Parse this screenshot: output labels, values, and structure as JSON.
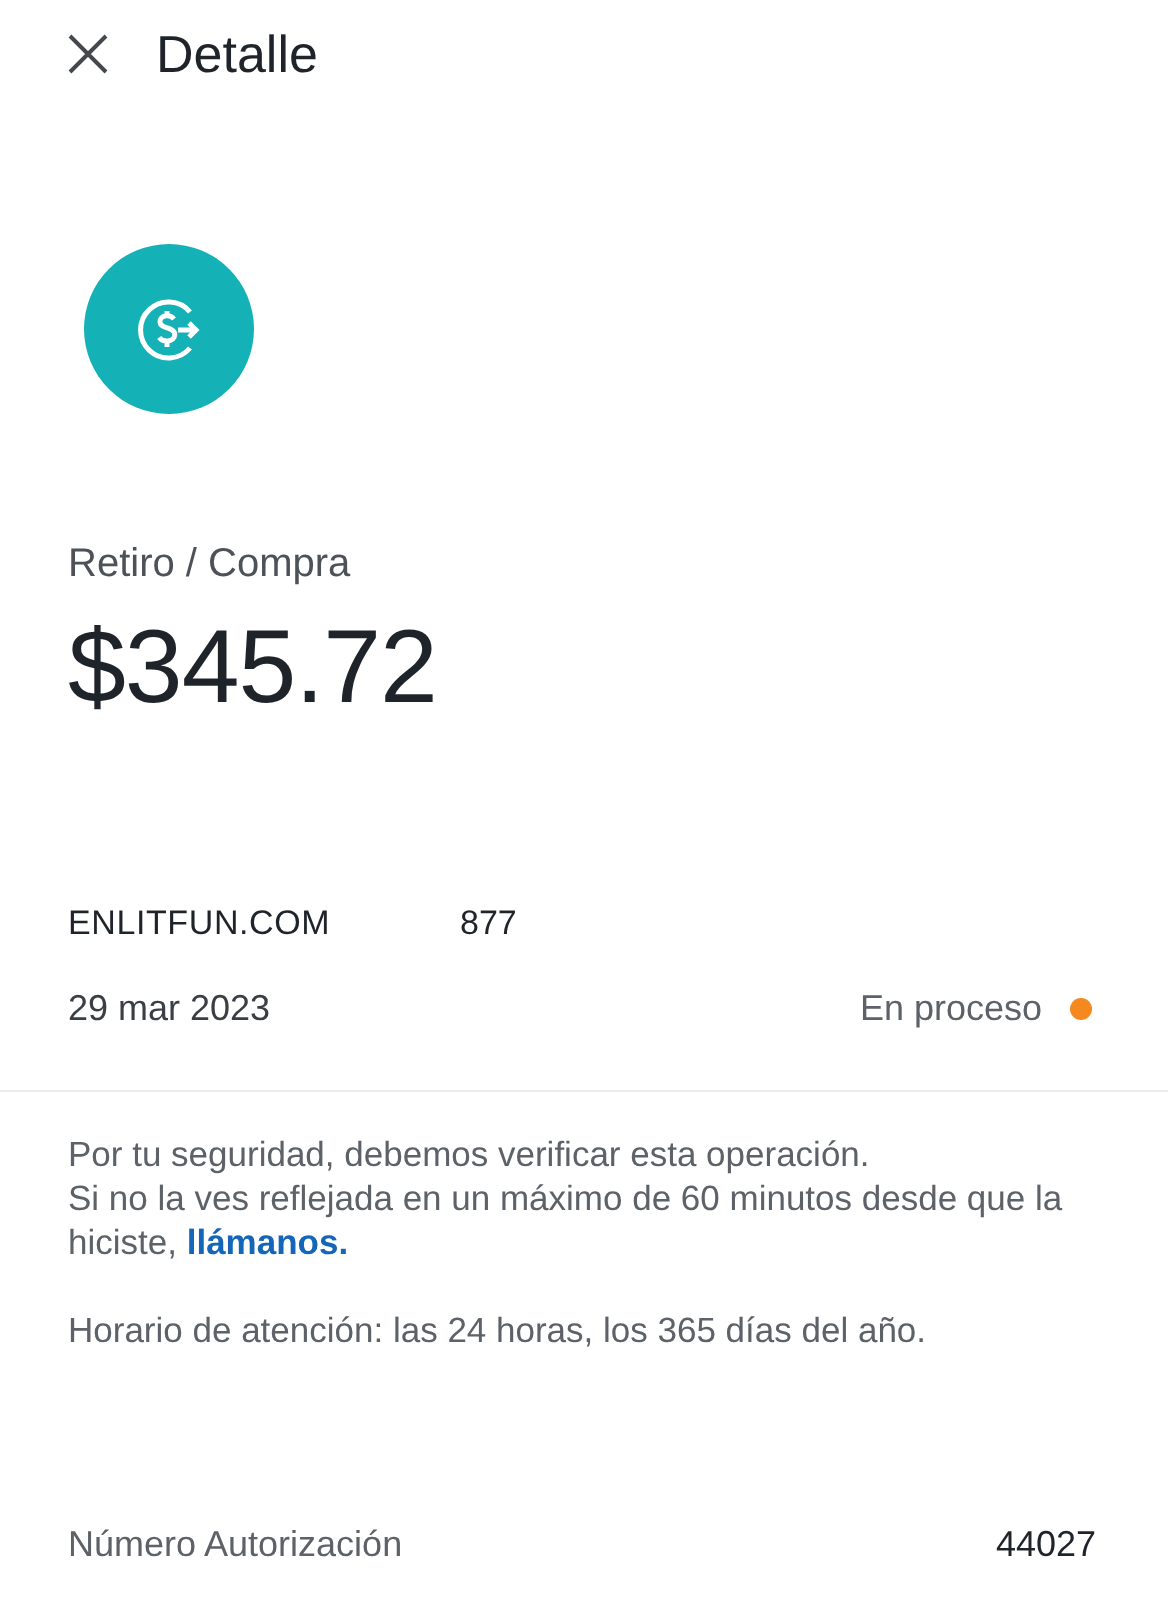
{
  "header": {
    "title": "Detalle"
  },
  "transaction": {
    "type": "Retiro / Compra",
    "amount": "$345.72",
    "merchant": "ENLITFUN.COM",
    "merchant_code": "877",
    "date": "29 mar 2023",
    "status": {
      "label": "En proceso",
      "color": "#f5891f"
    }
  },
  "notice": {
    "line_1": "Por tu seguridad, debemos verificar esta operación.",
    "line_2": "Si no la ves reflejada en un máximo de 60 minutos desde que la hiciste,",
    "link": "llámanos.",
    "hours": "Horario de atención: las 24 horas, los 365 días del año."
  },
  "authorization": {
    "label": "Número Autorización",
    "value": "44027"
  }
}
